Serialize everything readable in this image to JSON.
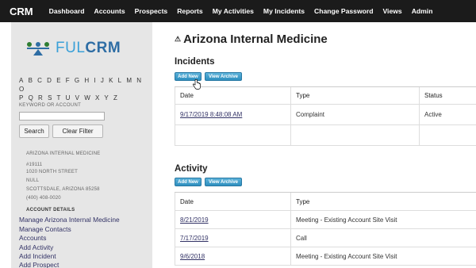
{
  "topbar": {
    "brand": "CRM",
    "nav": [
      "Dashboard",
      "Accounts",
      "Prospects",
      "Reports",
      "My Activities",
      "My Incidents",
      "Change Password",
      "Views",
      "Admin"
    ]
  },
  "sidebar": {
    "logo": {
      "ful": "FUL",
      "crm": "CRM"
    },
    "alphabet_row1": [
      "A",
      "B",
      "C",
      "D",
      "E",
      "F",
      "G",
      "H",
      "I",
      "J",
      "K",
      "L",
      "M",
      "N",
      "O"
    ],
    "alphabet_row2": [
      "P",
      "Q",
      "R",
      "S",
      "T",
      "U",
      "V",
      "W",
      "X",
      "Y",
      "Z"
    ],
    "keyword_label": "KEYWORD OR ACCOUNT",
    "keyword_value": "",
    "search_label": "Search",
    "clear_label": "Clear Filter",
    "address": [
      "ARIZONA INTERNAL MEDICINE",
      "#19111",
      "1020 NORTH STREET",
      "NULL",
      "SCOTTSDALE, ARIZONA 85258",
      "(400) 408-0020"
    ],
    "account_details": "ACCOUNT DETAILS",
    "links": [
      "Manage Arizona Internal Medicine",
      "Manage Contacts",
      "Accounts",
      "Add Activity",
      "Add Incident",
      "Add Prospect"
    ]
  },
  "main": {
    "title": "Arizona Internal Medicine",
    "incidents": {
      "heading": "Incidents",
      "add_new": "Add New",
      "view_archive": "View Archive",
      "headers": [
        "Date",
        "Type",
        "Status"
      ],
      "rows": [
        {
          "date": "9/17/2019 8:48:08 AM",
          "type": "Complaint",
          "status": "Active"
        }
      ]
    },
    "activity": {
      "heading": "Activity",
      "add_new": "Add New",
      "view_archive": "View Archive",
      "headers": [
        "Date",
        "Type"
      ],
      "rows": [
        {
          "date": "8/21/2019",
          "type": "Meeting - Existing Account Site Visit"
        },
        {
          "date": "7/17/2019",
          "type": "Call"
        },
        {
          "date": "9/6/2018",
          "type": "Meeting - Existing Account Site Visit"
        }
      ]
    }
  },
  "colors": {
    "topbar_bg": "#1b1b1b",
    "sidebar_bg": "#e6e6e6",
    "button_blue": "#2f8fbf",
    "link": "#333366"
  }
}
